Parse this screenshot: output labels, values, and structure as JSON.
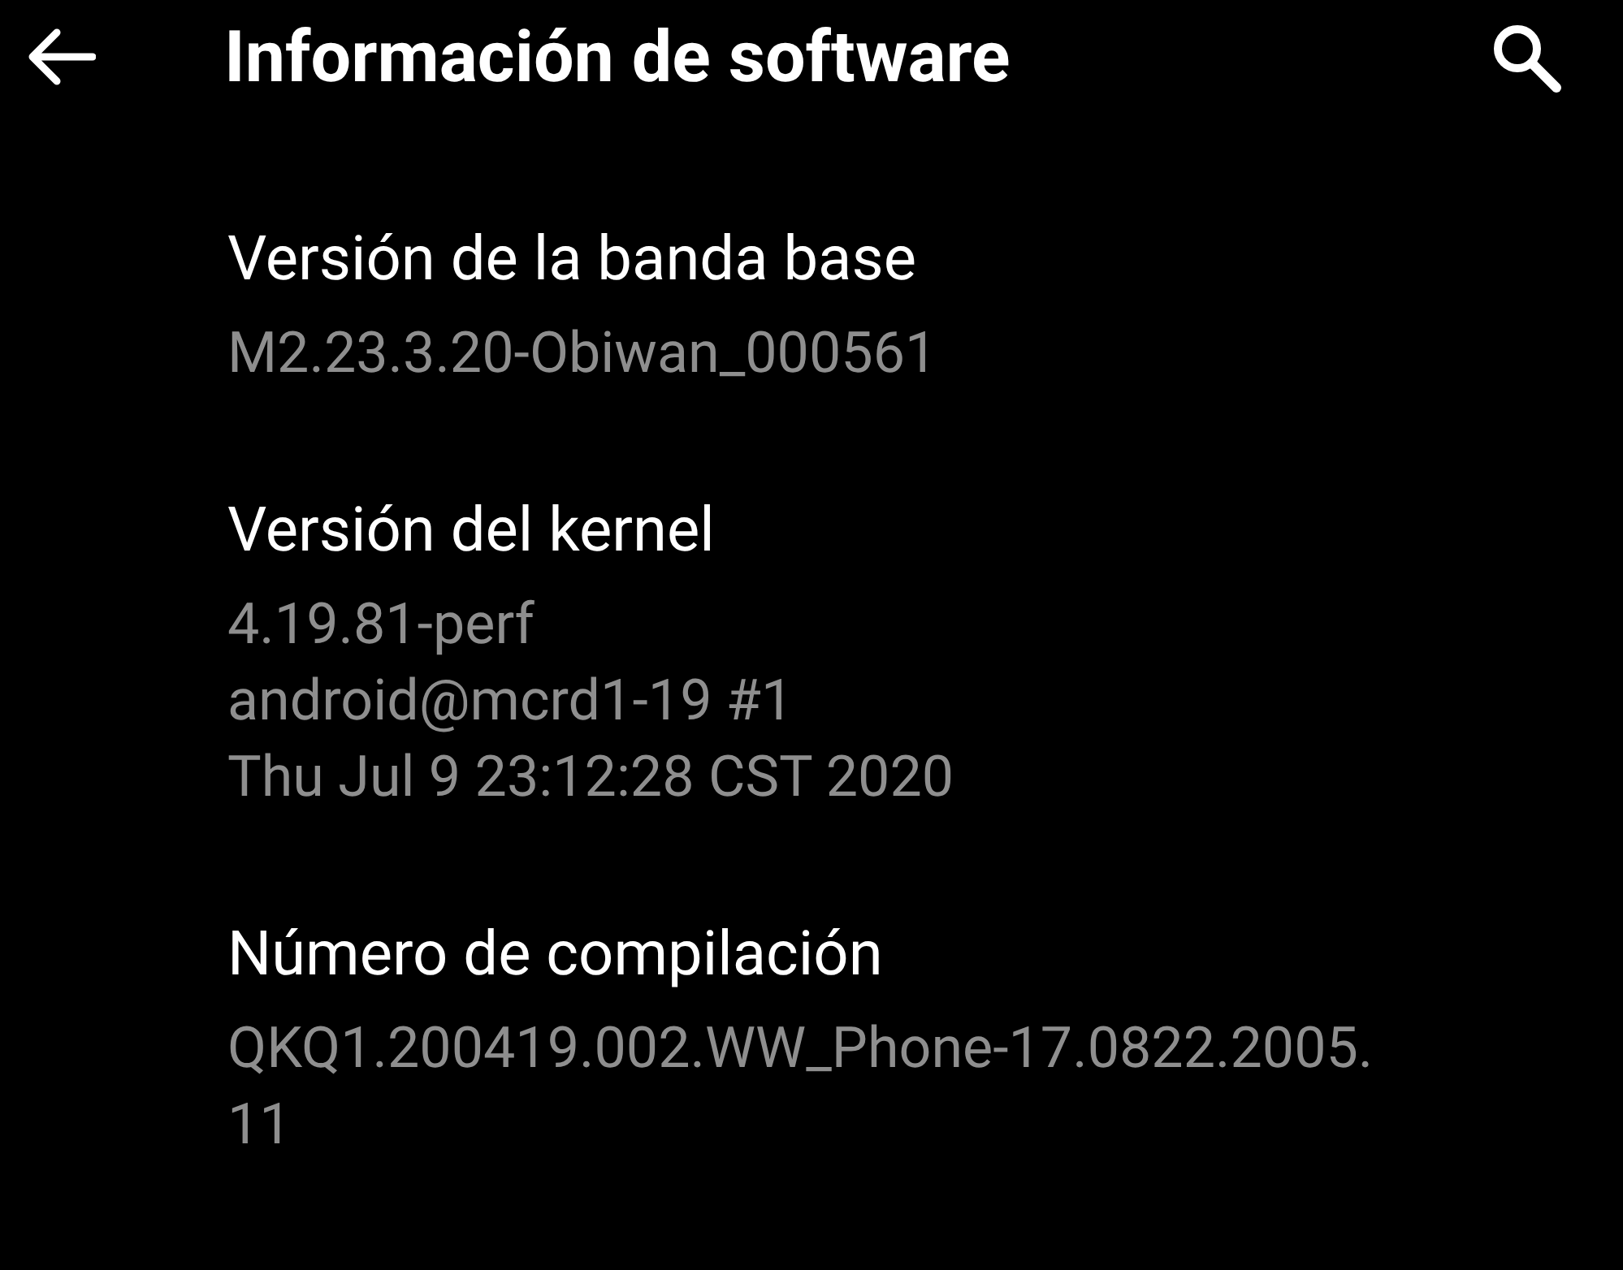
{
  "app_bar": {
    "title": "Información de software"
  },
  "items": [
    {
      "title": "Versión de la banda base",
      "lines": [
        "M2.23.3.20-Obiwan_000561"
      ]
    },
    {
      "title": "Versión del kernel",
      "lines": [
        "4.19.81-perf",
        "android@mcrd1-19 #1",
        "Thu Jul 9 23:12:28 CST 2020"
      ]
    },
    {
      "title": "Número de compilación",
      "lines": [
        "QKQ1.200419.002.WW_Phone-17.0822.2005.",
        "11"
      ]
    }
  ]
}
